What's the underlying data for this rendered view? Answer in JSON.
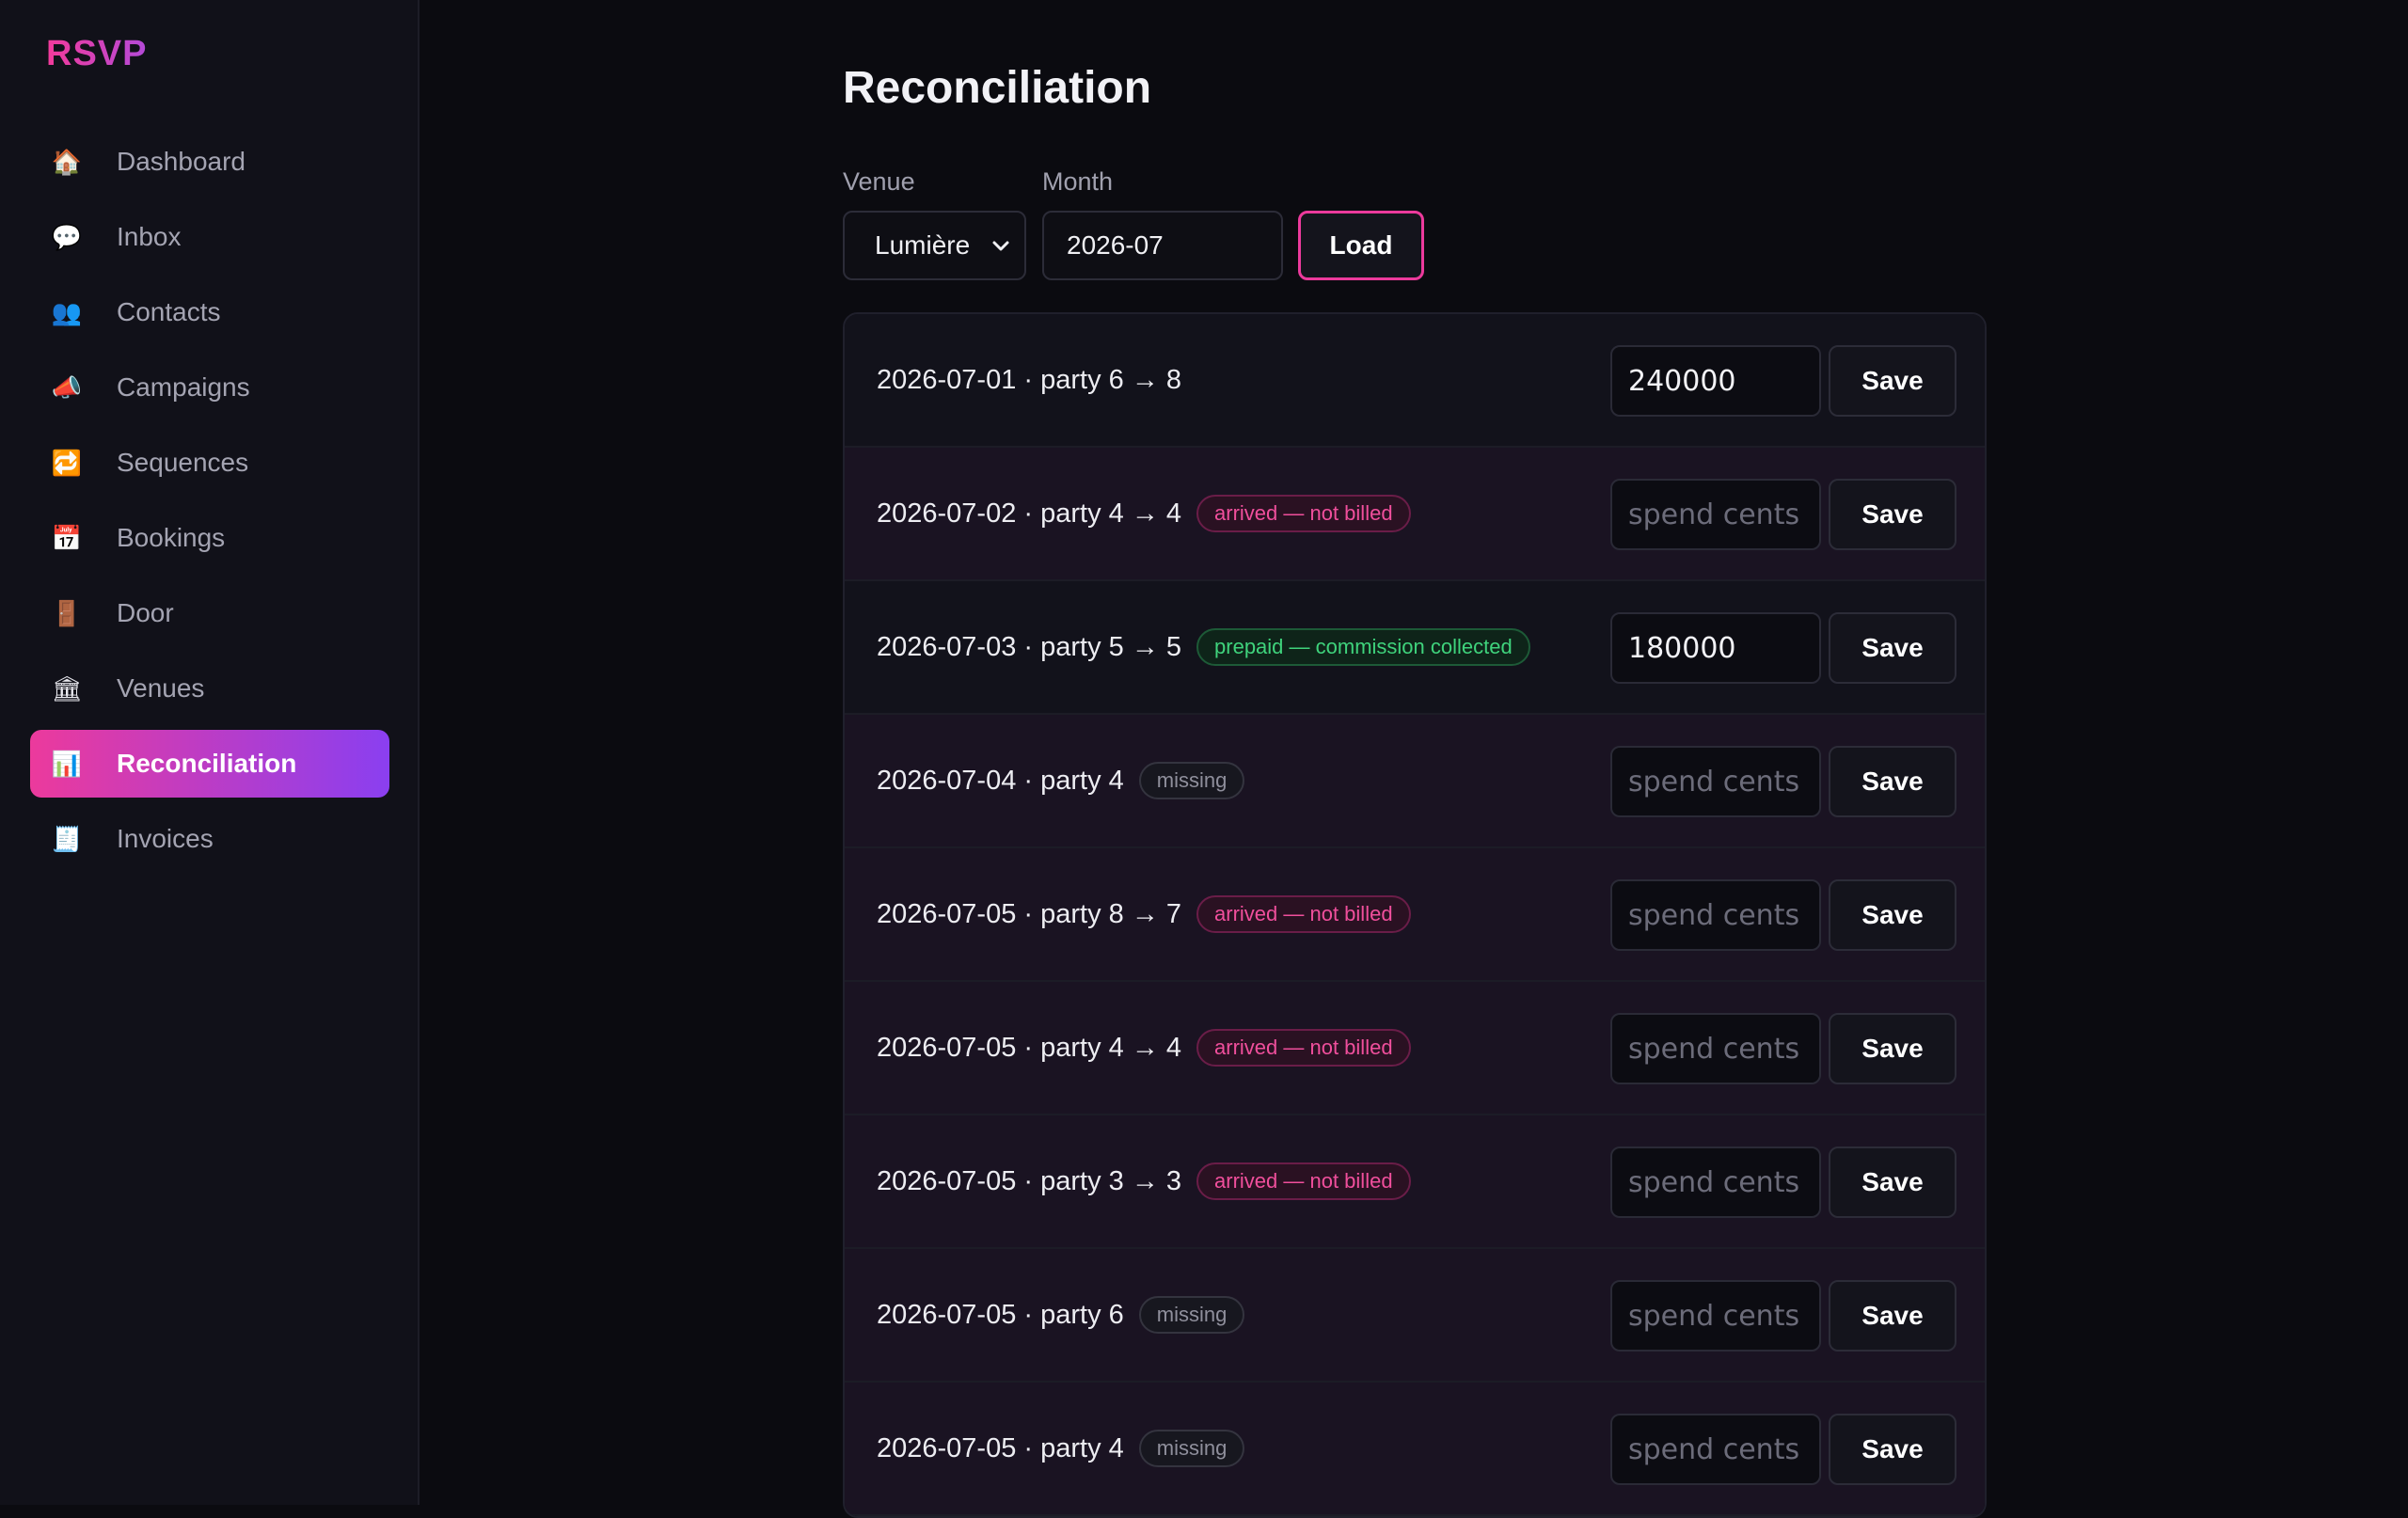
{
  "app": {
    "logo": "RSVP"
  },
  "sidebar": {
    "items": [
      {
        "label": "Dashboard",
        "icon": "🏠"
      },
      {
        "label": "Inbox",
        "icon": "💬"
      },
      {
        "label": "Contacts",
        "icon": "👥"
      },
      {
        "label": "Campaigns",
        "icon": "📣"
      },
      {
        "label": "Sequences",
        "icon": "🔁"
      },
      {
        "label": "Bookings",
        "icon": "📅"
      },
      {
        "label": "Door",
        "icon": "🚪"
      },
      {
        "label": "Venues",
        "icon": "🏛"
      },
      {
        "label": "Reconciliation",
        "icon": "📊",
        "active": true
      },
      {
        "label": "Invoices",
        "icon": "🧾"
      }
    ]
  },
  "page": {
    "title": "Reconciliation",
    "venue_label": "Venue",
    "venue_value": "Lumière",
    "month_label": "Month",
    "month_value": "2026-07",
    "load_label": "Load"
  },
  "rows": [
    {
      "text": "2026-07-01 · party 6 → 8",
      "badge": "",
      "badge_type": "",
      "value": "240000",
      "placeholder": "spend cents",
      "save": "Save"
    },
    {
      "text": "2026-07-02 · party 4 → 4",
      "badge": "arrived — not billed",
      "badge_type": "pink",
      "value": "",
      "placeholder": "spend cents",
      "save": "Save"
    },
    {
      "text": "2026-07-03 · party 5 → 5",
      "badge": "prepaid — commission collected",
      "badge_type": "green",
      "value": "180000",
      "placeholder": "spend cents",
      "save": "Save"
    },
    {
      "text": "2026-07-04 · party 4",
      "badge": "missing",
      "badge_type": "gray",
      "value": "",
      "placeholder": "spend cents",
      "save": "Save"
    },
    {
      "text": "2026-07-05 · party 8 → 7",
      "badge": "arrived — not billed",
      "badge_type": "pink",
      "value": "",
      "placeholder": "spend cents",
      "save": "Save"
    },
    {
      "text": "2026-07-05 · party 4 → 4",
      "badge": "arrived — not billed",
      "badge_type": "pink",
      "value": "",
      "placeholder": "spend cents",
      "save": "Save"
    },
    {
      "text": "2026-07-05 · party 3 → 3",
      "badge": "arrived — not billed",
      "badge_type": "pink",
      "value": "",
      "placeholder": "spend cents",
      "save": "Save"
    },
    {
      "text": "2026-07-05 · party 6",
      "badge": "missing",
      "badge_type": "gray",
      "value": "",
      "placeholder": "spend cents",
      "save": "Save"
    },
    {
      "text": "2026-07-05 · party 4",
      "badge": "missing",
      "badge_type": "gray",
      "value": "",
      "placeholder": "spend cents",
      "save": "Save"
    }
  ],
  "colors": {
    "accent_pink": "#ec3a9c",
    "accent_purple": "#8a3ff0",
    "badge_pink": "#f04f9c",
    "badge_green": "#3fd37c",
    "background": "#0b0b10"
  }
}
